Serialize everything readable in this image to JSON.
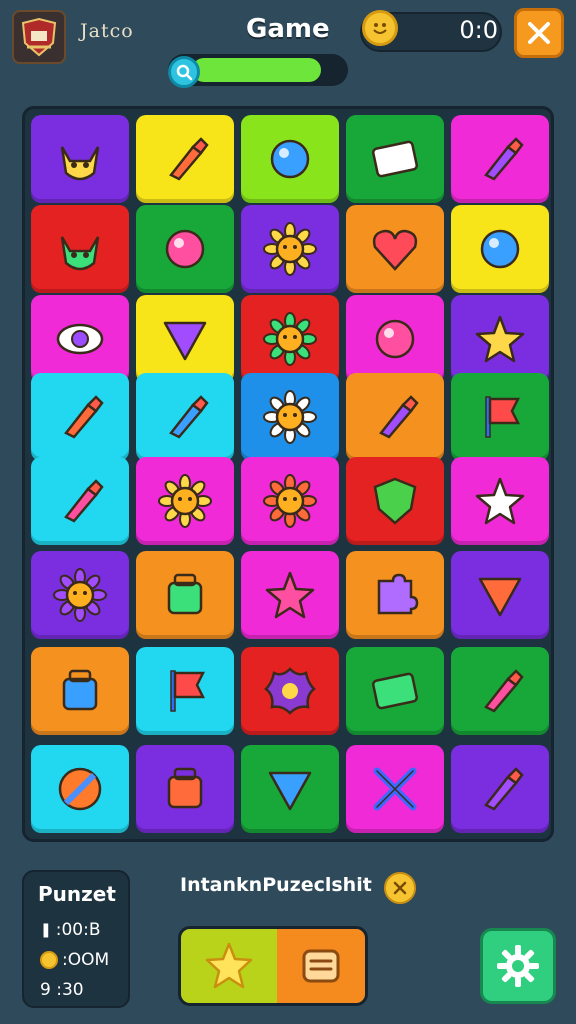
{
  "header": {
    "brand": "Jatco",
    "title": "Game",
    "score": "0:0",
    "level_progress": 0.85
  },
  "icons": {
    "logo": "crest-logo-icon",
    "coin": "smiley-coin-icon",
    "close": "close-icon",
    "search": "search-icon"
  },
  "board": {
    "rows": [
      [
        {
          "color": "#7a2ee0",
          "icon": "cat-face-icon"
        },
        {
          "color": "#f7e51a",
          "icon": "paintbrush-icon"
        },
        {
          "color": "#8ae41b",
          "icon": "blue-gem-icon"
        },
        {
          "color": "#18a83a",
          "icon": "eraser-icon"
        },
        {
          "color": "#f02ad6",
          "icon": "leaf-brush-icon"
        }
      ],
      [
        {
          "color": "#e42222",
          "icon": "cat-head-icon"
        },
        {
          "color": "#18a83a",
          "icon": "berry-icon"
        },
        {
          "color": "#7a2ee0",
          "icon": "flower-icon"
        },
        {
          "color": "#f5911f",
          "icon": "heart-rocket-icon"
        },
        {
          "color": "#f7e51a",
          "icon": "bug-icon"
        }
      ],
      [
        {
          "color": "#f02ad6",
          "icon": "eye-icon"
        },
        {
          "color": "#f7e51a",
          "icon": "funnel-icon"
        },
        {
          "color": "#e42222",
          "icon": "sun-face-icon"
        },
        {
          "color": "#f02ad6",
          "icon": "balloon-icon"
        },
        {
          "color": "#7a2ee0",
          "icon": "lime-star-icon"
        }
      ],
      [
        {
          "color": "#22d8f0",
          "icon": "marker-icon"
        },
        {
          "color": "#22d8f0",
          "icon": "brush-icon"
        },
        {
          "color": "#1e90ea",
          "icon": "sunflower-icon"
        },
        {
          "color": "#f5911f",
          "icon": "pin-icon"
        },
        {
          "color": "#18a83a",
          "icon": "red-flag-shape-icon"
        }
      ],
      [
        {
          "color": "#22d8f0",
          "icon": "crayon-icon"
        },
        {
          "color": "#f02ad6",
          "icon": "sun-icon"
        },
        {
          "color": "#f02ad6",
          "icon": "gear-flower-icon"
        },
        {
          "color": "#e42222",
          "icon": "shield-icon"
        },
        {
          "color": "#f02ad6",
          "icon": "blue-star-icon"
        }
      ],
      [
        {
          "color": "#7a2ee0",
          "icon": "smiling-sun-icon"
        },
        {
          "color": "#f5911f",
          "icon": "jar-icon"
        },
        {
          "color": "#f02ad6",
          "icon": "star-icon"
        },
        {
          "color": "#f5911f",
          "icon": "puzzle-piece-icon"
        },
        {
          "color": "#7a2ee0",
          "icon": "triangle-ruler-icon"
        }
      ],
      [
        {
          "color": "#f5911f",
          "icon": "basket-icon"
        },
        {
          "color": "#22d8f0",
          "icon": "flag-icon"
        },
        {
          "color": "#e42222",
          "icon": "splat-icon"
        },
        {
          "color": "#18a83a",
          "icon": "sketchpad-icon"
        },
        {
          "color": "#18a83a",
          "icon": "feather-icon"
        }
      ],
      [
        {
          "color": "#22d8f0",
          "icon": "rainbow-ball-icon"
        },
        {
          "color": "#7a2ee0",
          "icon": "toolbox-icon"
        },
        {
          "color": "#18a83a",
          "icon": "witch-hat-icon"
        },
        {
          "color": "#f02ad6",
          "icon": "crossed-tools-icon"
        },
        {
          "color": "#7a2ee0",
          "icon": "bucket-brush-icon"
        }
      ]
    ]
  },
  "stats": {
    "title": "Punzet",
    "row1": ":00:B",
    "row2": ":OOM",
    "row3": "9 :30"
  },
  "hint": {
    "text": "IntanknPuzeclshit"
  },
  "actions": {
    "star": "star-icon",
    "list": "list-icon",
    "settings": "settings-gear-icon"
  },
  "colors": {
    "background": "#2f4a5a",
    "board": "#1e3340",
    "accent_orange": "#f59a1f",
    "accent_green": "#2fcf7f"
  }
}
